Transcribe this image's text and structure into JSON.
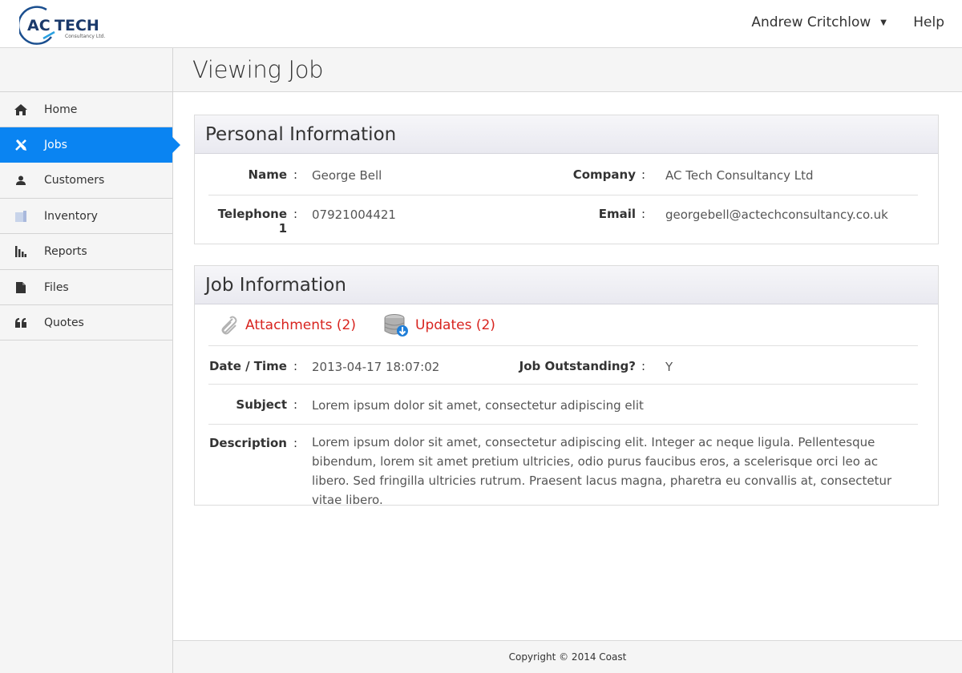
{
  "header": {
    "logo_text": "AC TECH",
    "logo_subtext": "Consultancy Ltd.",
    "user_name": "Andrew Critchlow",
    "help_label": "Help"
  },
  "sidebar": {
    "items": [
      {
        "label": "Home",
        "icon": "home-icon"
      },
      {
        "label": "Jobs",
        "icon": "tools-icon",
        "active": true
      },
      {
        "label": "Customers",
        "icon": "user-icon"
      },
      {
        "label": "Inventory",
        "icon": "inventory-icon"
      },
      {
        "label": "Reports",
        "icon": "bar-chart-icon"
      },
      {
        "label": "Files",
        "icon": "file-icon"
      },
      {
        "label": "Quotes",
        "icon": "quote-icon"
      }
    ],
    "active_color": "#0a84f2"
  },
  "page": {
    "title": "Viewing Job"
  },
  "personal_info": {
    "heading": "Personal Information",
    "name_label": "Name",
    "name_value": "George Bell",
    "company_label": "Company",
    "company_value": "AC Tech Consultancy Ltd",
    "telephone_label": "Telephone 1",
    "telephone_value": "07921004421",
    "email_label": "Email",
    "email_value": "georgebell@actechconsultancy.co.uk"
  },
  "job_info": {
    "heading": "Job Information",
    "attachments_label": "Attachments (2)",
    "updates_label": "Updates (2)",
    "datetime_label": "Date / Time",
    "datetime_value": "2013-04-17 18:07:02",
    "outstanding_label": "Job Outstanding?",
    "outstanding_value": "Y",
    "subject_label": "Subject",
    "subject_value": "Lorem ipsum dolor sit amet, consectetur adipiscing elit",
    "description_label": "Description",
    "description_value": "Lorem ipsum dolor sit amet, consectetur adipiscing elit. Integer ac neque ligula. Pellentesque bibendum, lorem sit amet pretium ultricies, odio purus faucibus eros, a scelerisque orci leo ac libero. Sed fringilla ultricies rutrum. Praesent lacus magna, pharetra eu convallis at, consectetur vitae libero."
  },
  "colon": ":",
  "footer": {
    "copyright": "Copyright © 2014 Coast"
  },
  "colors": {
    "link_red": "#d8241f",
    "logo_blue": "#1b4f8f"
  }
}
